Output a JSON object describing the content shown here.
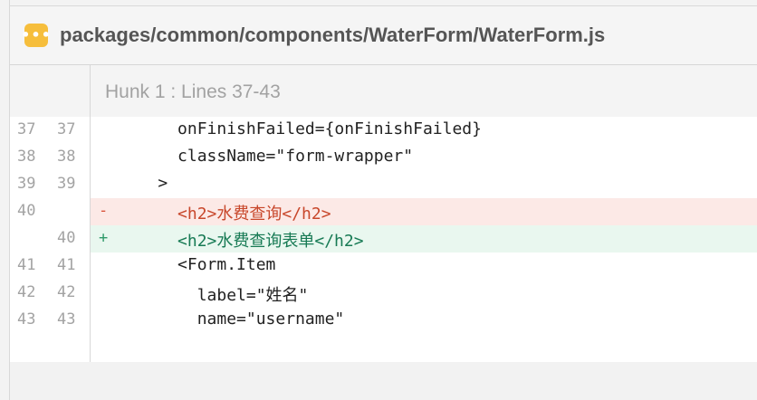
{
  "header": {
    "badge_glyph": "•••",
    "file_path": "packages/common/components/WaterForm/WaterForm.js"
  },
  "hunk": {
    "label": "Hunk 1 : Lines 37-43"
  },
  "lines": [
    {
      "old": "37",
      "new": "37",
      "marker": "",
      "type": "context",
      "text": "      onFinishFailed={onFinishFailed}"
    },
    {
      "old": "38",
      "new": "38",
      "marker": "",
      "type": "context",
      "text": "      className=\"form-wrapper\""
    },
    {
      "old": "39",
      "new": "39",
      "marker": "",
      "type": "context",
      "text": "    >"
    },
    {
      "old": "40",
      "new": "",
      "marker": "-",
      "type": "del",
      "text": "      <h2>水费查询</h2>"
    },
    {
      "old": "",
      "new": "40",
      "marker": "+",
      "type": "add",
      "text": "      <h2>水费查询表单</h2>"
    },
    {
      "old": "41",
      "new": "41",
      "marker": "",
      "type": "context",
      "text": "      <Form.Item"
    },
    {
      "old": "42",
      "new": "42",
      "marker": "",
      "type": "context",
      "text": "        label=\"姓名\""
    },
    {
      "old": "43",
      "new": "43",
      "marker": "",
      "type": "context",
      "text": "        name=\"username\""
    }
  ],
  "colors": {
    "badge": "#f6be3c",
    "deleted_bg": "#fce9e6",
    "added_bg": "#e9f7ef",
    "deleted_text": "#c8472b",
    "added_text": "#177a54"
  }
}
